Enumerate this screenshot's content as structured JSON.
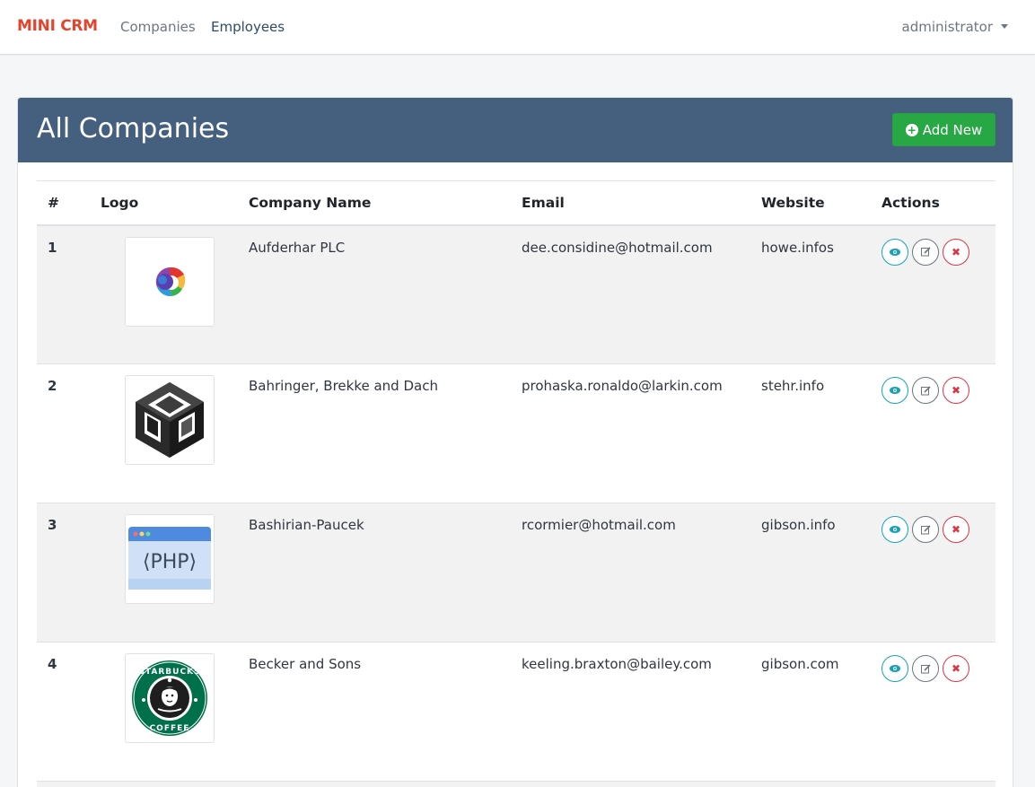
{
  "nav": {
    "brand": "MINI CRM",
    "links": [
      {
        "label": "Companies",
        "active": false
      },
      {
        "label": "Employees",
        "active": true
      }
    ],
    "user": "administrator"
  },
  "card": {
    "title": "All Companies",
    "add_button_label": "Add New",
    "add_icon": "plus-circle-icon"
  },
  "table": {
    "headers": [
      "#",
      "Logo",
      "Company Name",
      "Email",
      "Website",
      "Actions"
    ],
    "rows": [
      {
        "num": "1",
        "logo": "colorful-globe-logo",
        "name": "Aufderhar PLC",
        "email": "dee.considine@hotmail.com",
        "website": "howe.infos"
      },
      {
        "num": "2",
        "logo": "unity-cube-logo",
        "name": "Bahringer, Brekke and Dach",
        "email": "prohaska.ronaldo@larkin.com",
        "website": "stehr.info"
      },
      {
        "num": "3",
        "logo": "php-window-logo",
        "name": "Bashirian-Paucek",
        "email": "rcormier@hotmail.com",
        "website": "gibson.info"
      },
      {
        "num": "4",
        "logo": "starbucks-coffee-logo",
        "name": "Becker and Sons",
        "email": "keeling.braxton@bailey.com",
        "website": "gibson.com"
      }
    ],
    "action_icons": [
      "eye-icon",
      "edit-icon",
      "close-icon"
    ]
  },
  "colors": {
    "brand": "#e0452e",
    "header_bg": "#44607e",
    "add_button": "#27a844",
    "view": "#17a2b8",
    "edit": "#6c757d",
    "delete": "#dc3545"
  }
}
